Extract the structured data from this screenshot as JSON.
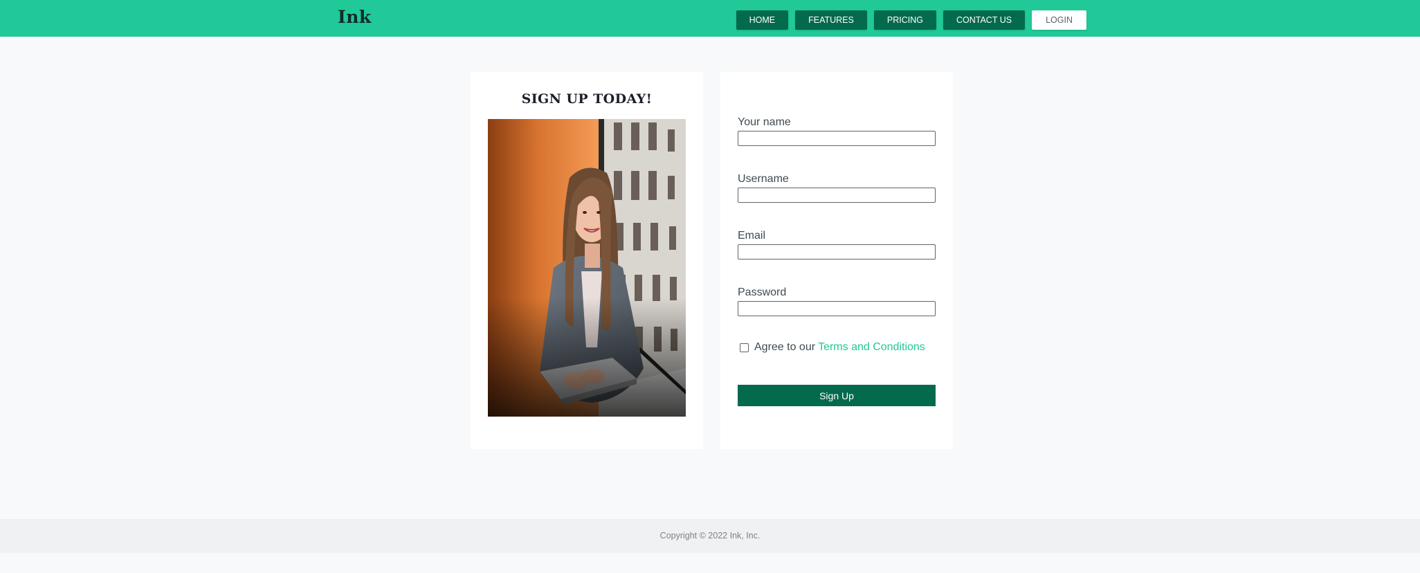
{
  "header": {
    "brand": "Ink",
    "nav": [
      {
        "label": "HOME"
      },
      {
        "label": "FEATURES"
      },
      {
        "label": "PRICING"
      },
      {
        "label": "CONTACT US"
      },
      {
        "label": "LOGIN"
      }
    ]
  },
  "signup_card": {
    "title": "SIGN UP TODAY!"
  },
  "form": {
    "fields": [
      {
        "label": "Your name",
        "value": ""
      },
      {
        "label": "Username",
        "value": ""
      },
      {
        "label": "Email",
        "value": ""
      },
      {
        "label": "Password",
        "value": ""
      }
    ],
    "agree_text": "Agree to our",
    "terms_link": "Terms and Conditions",
    "submit_label": "Sign Up"
  },
  "footer": {
    "copyright": "Copyright © 2022 Ink, Inc."
  },
  "colors": {
    "accent": "#20c997",
    "primary_dark": "#046a4d",
    "background": "#f8f9fa"
  }
}
